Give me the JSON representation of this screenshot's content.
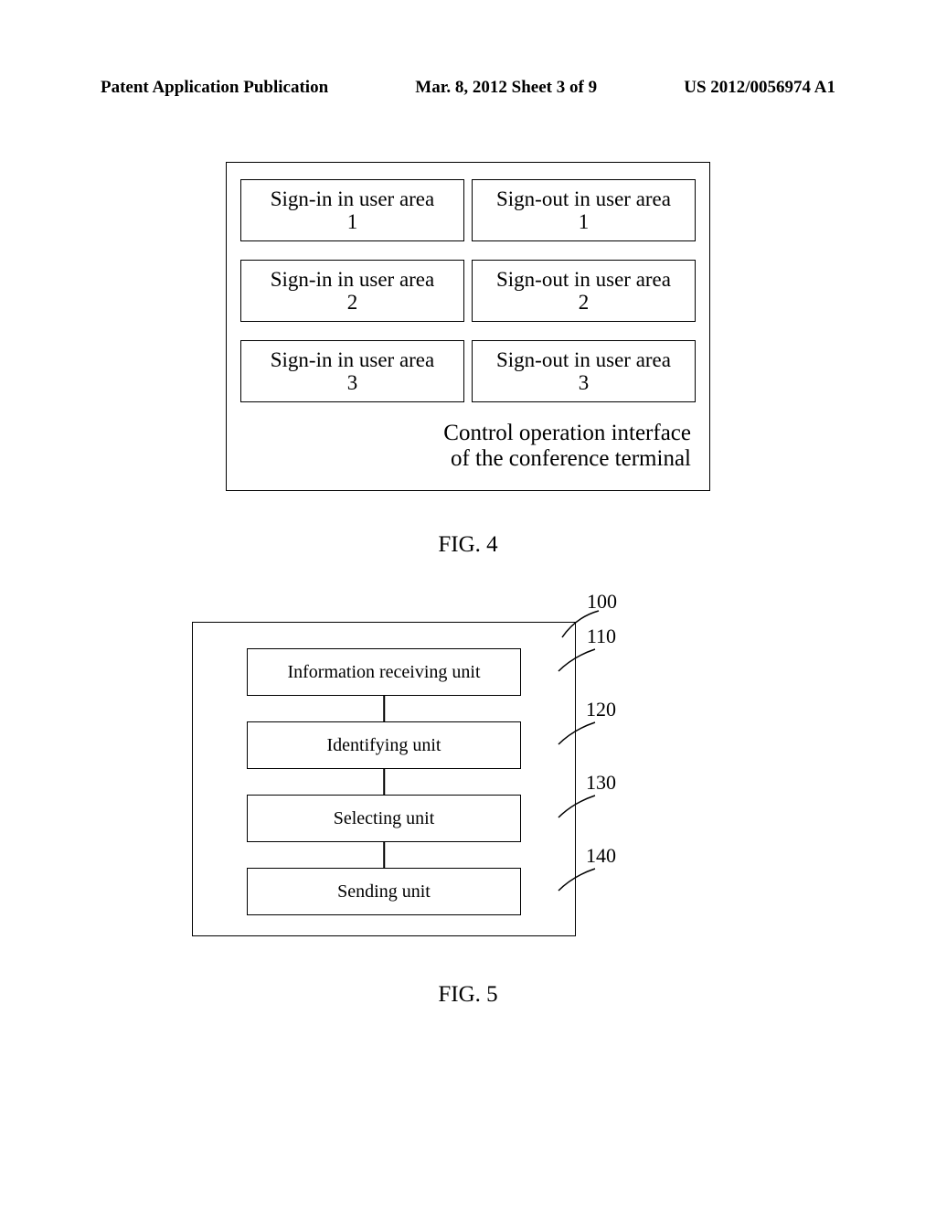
{
  "header": {
    "left": "Patent Application Publication",
    "center": "Mar. 8, 2012  Sheet 3 of 9",
    "right": "US 2012/0056974 A1"
  },
  "fig4": {
    "rows": [
      {
        "left_line1": "Sign-in in user area",
        "left_line2": "1",
        "right_line1": "Sign-out in user area",
        "right_line2": "1"
      },
      {
        "left_line1": "Sign-in in user area",
        "left_line2": "2",
        "right_line1": "Sign-out in user area",
        "right_line2": "2"
      },
      {
        "left_line1": "Sign-in in user area",
        "left_line2": "3",
        "right_line1": "Sign-out in user area",
        "right_line2": "3"
      }
    ],
    "caption_line1": "Control operation interface",
    "caption_line2": "of the conference terminal",
    "label": "FIG. 4"
  },
  "fig5": {
    "ref_outer": "100",
    "units": [
      {
        "label": "Information receiving unit",
        "ref": "110"
      },
      {
        "label": "Identifying unit",
        "ref": "120"
      },
      {
        "label": "Selecting unit",
        "ref": "130"
      },
      {
        "label": "Sending unit",
        "ref": "140"
      }
    ],
    "label": "FIG. 5"
  }
}
